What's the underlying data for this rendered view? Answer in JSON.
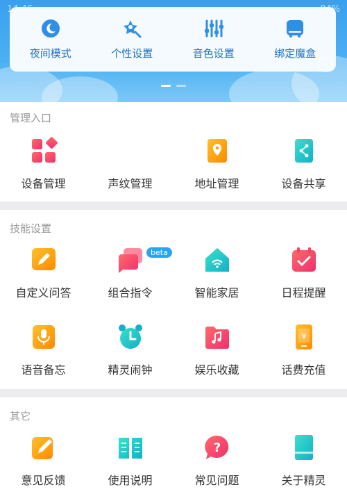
{
  "status": {
    "time": "14:46",
    "battery": "84%"
  },
  "quick_actions": [
    {
      "label": "夜间模式",
      "icon": "moon-icon"
    },
    {
      "label": "个性设置",
      "icon": "star-brush-icon"
    },
    {
      "label": "音色设置",
      "icon": "equalizer-icon"
    },
    {
      "label": "绑定魔盒",
      "icon": "magic-box-icon"
    }
  ],
  "management": {
    "title": "管理入口",
    "items": [
      {
        "label": "设备管理",
        "icon": "grid-icon",
        "color": "#f0455c"
      },
      {
        "label": "声纹管理",
        "icon": "voiceprint-icon",
        "color": "#f0455c"
      },
      {
        "label": "地址管理",
        "icon": "location-icon",
        "color": "#ffa800"
      },
      {
        "label": "设备共享",
        "icon": "share-icon",
        "color": "#22c7b5"
      }
    ]
  },
  "skills": {
    "title": "技能设置",
    "items": [
      {
        "label": "自定义问答",
        "icon": "pencil-icon",
        "color": "#ffa800"
      },
      {
        "label": "组合指令",
        "icon": "chat-icon",
        "color": "#f0455c",
        "badge": "beta"
      },
      {
        "label": "智能家居",
        "icon": "smart-home-icon",
        "color": "#22c7b5"
      },
      {
        "label": "日程提醒",
        "icon": "calendar-check-icon",
        "color": "#f0455c"
      },
      {
        "label": "语音备忘",
        "icon": "microphone-icon",
        "color": "#ffa800"
      },
      {
        "label": "精灵闹钟",
        "icon": "alarm-clock-icon",
        "color": "#22c7b5"
      },
      {
        "label": "娱乐收藏",
        "icon": "music-folder-icon",
        "color": "#f0455c"
      },
      {
        "label": "话费充值",
        "icon": "phone-yuan-icon",
        "color": "#ffa800"
      }
    ]
  },
  "others": {
    "title": "其它",
    "items": [
      {
        "label": "意见反馈",
        "icon": "feedback-edit-icon",
        "color": "#ffa800"
      },
      {
        "label": "使用说明",
        "icon": "manual-book-icon",
        "color": "#22c7b5"
      },
      {
        "label": "常见问题",
        "icon": "question-bubble-icon",
        "color": "#f0455c"
      },
      {
        "label": "关于精灵",
        "icon": "about-device-icon",
        "color": "#22c7b5"
      }
    ]
  }
}
